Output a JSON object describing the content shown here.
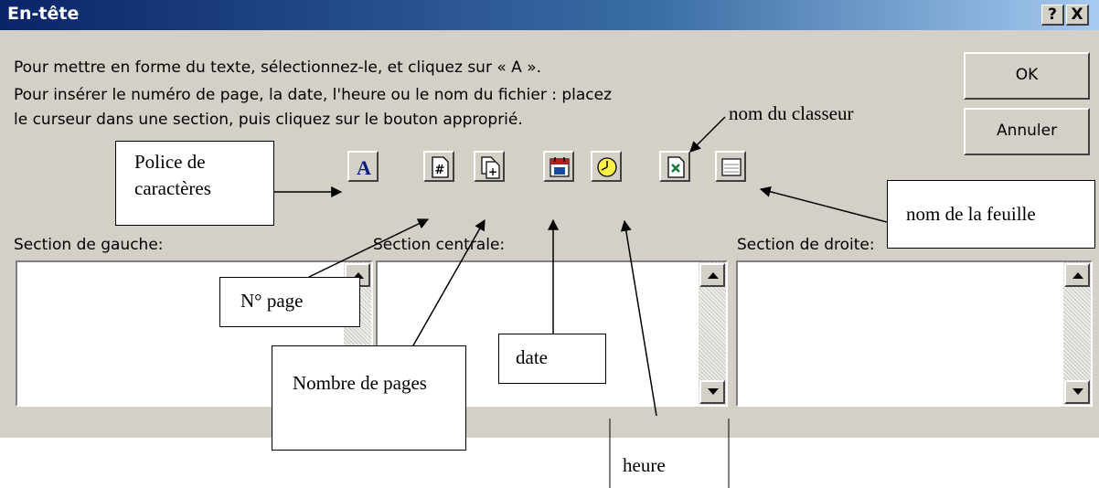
{
  "window": {
    "title": "En-tête",
    "help_label": "?",
    "close_label": "X"
  },
  "instructions": [
    "Pour mettre en forme du texte, sélectionnez-le, et cliquez sur « A ».",
    "Pour insérer le numéro de page, la date, l'heure ou le nom du fichier : placez",
    "le curseur dans une section, puis cliquez sur le bouton approprié."
  ],
  "buttons": {
    "ok": "OK",
    "cancel": "Annuler"
  },
  "toolbar": [
    {
      "icon": "font-a-icon",
      "glyph": "A"
    },
    {
      "icon": "page-number-icon",
      "glyph": "#"
    },
    {
      "icon": "page-count-icon",
      "glyph": "+"
    },
    {
      "icon": "date-icon"
    },
    {
      "icon": "clock-icon"
    },
    {
      "icon": "workbook-name-icon"
    },
    {
      "icon": "sheet-name-icon"
    }
  ],
  "sections": {
    "left": {
      "label": "Section de gauche:",
      "value": ""
    },
    "center": {
      "label": "Section centrale:",
      "value": ""
    },
    "right": {
      "label": "Section de droite:",
      "value": ""
    }
  },
  "annotations": {
    "font": "Police de caractères",
    "page_number": "N° page",
    "page_count": "Nombre de pages",
    "date": "date",
    "time": "heure",
    "workbook": "nom du classeur",
    "sheet": "nom de la feuille"
  }
}
